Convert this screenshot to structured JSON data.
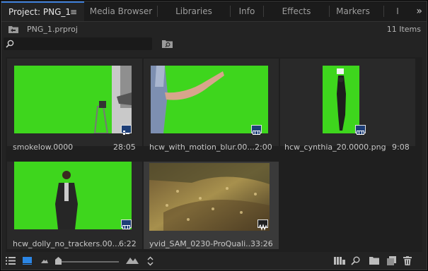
{
  "tabs": [
    {
      "label": "Project: PNG_1",
      "active": true
    },
    {
      "label": "Media Browser"
    },
    {
      "label": "Libraries"
    },
    {
      "label": "Info"
    },
    {
      "label": "Effects"
    },
    {
      "label": "Markers"
    },
    {
      "label": "I"
    }
  ],
  "tab_menu_glyph": "≡",
  "overflow_glyph": "»",
  "project": {
    "file": "PNG_1.prproj",
    "item_count": "11 Items"
  },
  "search": {
    "placeholder": ""
  },
  "clips": [
    {
      "name": "smokelow.0000",
      "duration": "28:05",
      "badge": "sequence"
    },
    {
      "name": "hcw_with_motion_blur.00...",
      "duration": "2:00",
      "badge": "film"
    },
    {
      "name": "hcw_cynthia_20.0000.png",
      "duration": "9:08",
      "badge": "film"
    },
    {
      "name": "hcw_dolly_no_trackers.00...",
      "duration": "6:22",
      "badge": "film"
    },
    {
      "name": "yvid_SAM_0230-ProQuali...",
      "duration": "33:26",
      "badge": "audio-video",
      "selected": true
    }
  ],
  "zoom": {
    "level": 0.05
  },
  "colors": {
    "greenscreen": "#3ed61d",
    "accent": "#3a7bd5",
    "panel": "#232323",
    "badge": "#1e3f77"
  },
  "icons": [
    "folder-up-icon",
    "search-icon",
    "new-bin-search-icon",
    "list-view-icon",
    "icon-view-icon",
    "zoom-small-icon",
    "zoom-large-icon",
    "sort-icon",
    "automate-to-sequence-icon",
    "find-icon",
    "new-bin-icon",
    "new-item-icon",
    "trash-icon"
  ]
}
